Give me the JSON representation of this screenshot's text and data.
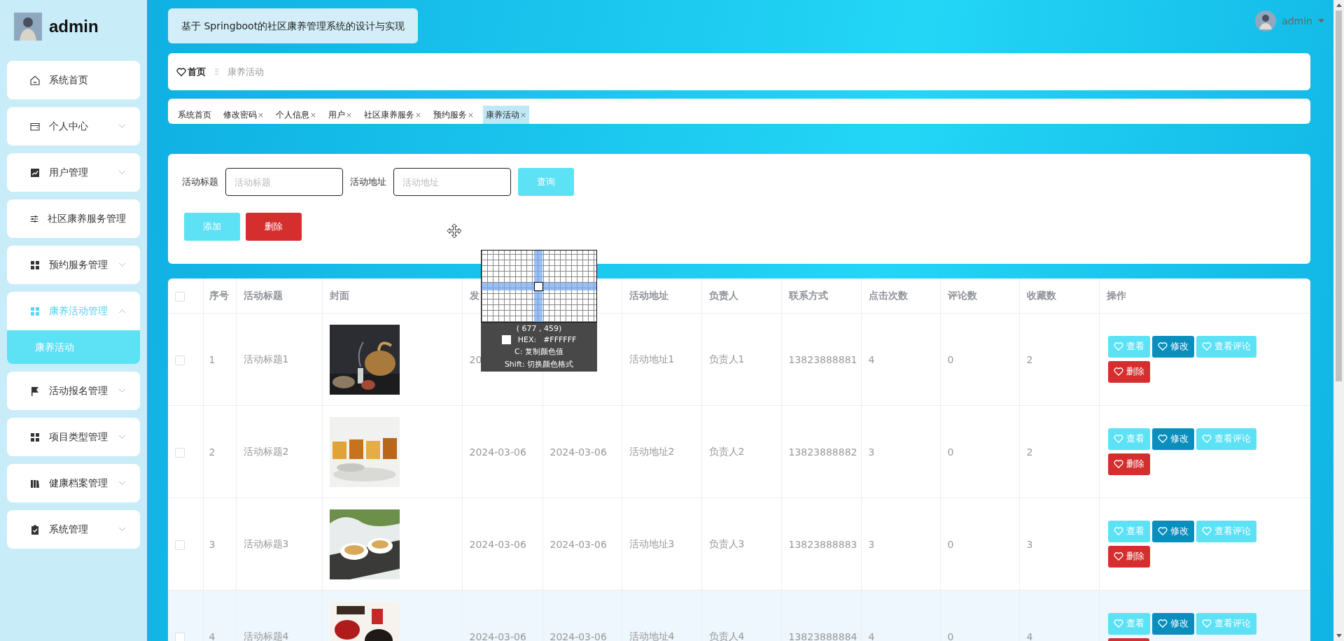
{
  "sidebar": {
    "username": "admin",
    "items": [
      {
        "label": "系统首页",
        "expandable": false,
        "expanded": false
      },
      {
        "label": "个人中心",
        "expandable": true,
        "expanded": false
      },
      {
        "label": "用户管理",
        "expandable": true,
        "expanded": false
      },
      {
        "label": "社区康养服务管理",
        "expandable": false,
        "expanded": false
      },
      {
        "label": "预约服务管理",
        "expandable": true,
        "expanded": false
      },
      {
        "label": "康养活动管理",
        "expandable": true,
        "expanded": true,
        "children": [
          {
            "label": "康养活动",
            "selected": true
          }
        ]
      },
      {
        "label": "活动报名管理",
        "expandable": true,
        "expanded": false
      },
      {
        "label": "项目类型管理",
        "expandable": true,
        "expanded": false
      },
      {
        "label": "健康档案管理",
        "expandable": true,
        "expanded": false
      },
      {
        "label": "系统管理",
        "expandable": true,
        "expanded": false
      }
    ]
  },
  "header": {
    "title": "基于 Springboot的社区康养管理系统的设计与实现",
    "user": "admin"
  },
  "breadcrumb": {
    "home": "首页",
    "current": "康养活动"
  },
  "tabs": [
    {
      "label": "系统首页",
      "closable": false,
      "selected": false
    },
    {
      "label": "修改密码",
      "closable": true,
      "selected": false
    },
    {
      "label": "个人信息",
      "closable": true,
      "selected": false
    },
    {
      "label": "用户",
      "closable": true,
      "selected": false
    },
    {
      "label": "社区康养服务",
      "closable": true,
      "selected": false
    },
    {
      "label": "预约服务",
      "closable": true,
      "selected": false
    },
    {
      "label": "康养活动",
      "closable": true,
      "selected": true
    }
  ],
  "search": {
    "fields": [
      {
        "label": "活动标题",
        "placeholder": "活动标题"
      },
      {
        "label": "活动地址",
        "placeholder": "活动地址"
      }
    ],
    "query_button": "查询",
    "actions": [
      {
        "label": "添加",
        "kind": "add"
      },
      {
        "label": "删除",
        "kind": "delete"
      }
    ]
  },
  "table": {
    "select_all_checked": false,
    "columns": [
      {
        "label": "序号"
      },
      {
        "label": "活动标题"
      },
      {
        "label": "封面"
      },
      {
        "label": "发"
      },
      {},
      {
        "label": "活动地址"
      },
      {
        "label": "负责人"
      },
      {
        "label": "联系方式"
      },
      {
        "label": "点击次数"
      },
      {
        "label": "评论数"
      },
      {
        "label": "收藏数"
      },
      {
        "label": "操作"
      }
    ],
    "rows": [
      {
        "index": "1",
        "title": "活动标题1",
        "start": "20",
        "address": "活动地址1",
        "manager": "负责人1",
        "phone": "13823888881",
        "clicks": "4",
        "comments": "0",
        "favorites": "2",
        "checked": false,
        "highlighted": false,
        "actions": [
          {
            "label": "查看",
            "kind": "view"
          },
          {
            "label": "修改",
            "kind": "edit"
          },
          {
            "label": "查看评论",
            "kind": "comments"
          },
          {
            "label": "删除",
            "kind": "delete"
          }
        ]
      },
      {
        "index": "2",
        "title": "活动标题2",
        "start": "2024-03-06",
        "end": "2024-03-06",
        "address": "活动地址2",
        "manager": "负责人2",
        "phone": "13823888882",
        "clicks": "3",
        "comments": "0",
        "favorites": "2",
        "checked": false,
        "highlighted": false,
        "actions": [
          {
            "label": "查看",
            "kind": "view"
          },
          {
            "label": "修改",
            "kind": "edit"
          },
          {
            "label": "查看评论",
            "kind": "comments"
          },
          {
            "label": "删除",
            "kind": "delete"
          }
        ]
      },
      {
        "index": "3",
        "title": "活动标题3",
        "start": "2024-03-06",
        "end": "2024-03-06",
        "address": "活动地址3",
        "manager": "负责人3",
        "phone": "13823888883",
        "clicks": "3",
        "comments": "0",
        "favorites": "3",
        "checked": false,
        "highlighted": false,
        "actions": [
          {
            "label": "查看",
            "kind": "view"
          },
          {
            "label": "修改",
            "kind": "edit"
          },
          {
            "label": "查看评论",
            "kind": "comments"
          },
          {
            "label": "删除",
            "kind": "delete"
          }
        ]
      },
      {
        "index": "4",
        "title": "活动标题4",
        "start": "2024-03-06",
        "end": "2024-03-06",
        "address": "活动地址4",
        "manager": "负责人4",
        "phone": "13823888884",
        "clicks": "4",
        "comments": "0",
        "favorites": "4",
        "checked": false,
        "highlighted": true,
        "actions": [
          {
            "label": "查看",
            "kind": "view"
          },
          {
            "label": "修改",
            "kind": "edit"
          },
          {
            "label": "查看评论",
            "kind": "comments"
          },
          {
            "kind": "delete"
          }
        ]
      }
    ]
  },
  "color_picker": {
    "coords": "( 677 ,  459)",
    "hex_label": "HEX:",
    "hex": "#FFFFFF",
    "hints": [
      "C: 复制颜色值",
      "Shift: 切换颜色格式"
    ]
  }
}
